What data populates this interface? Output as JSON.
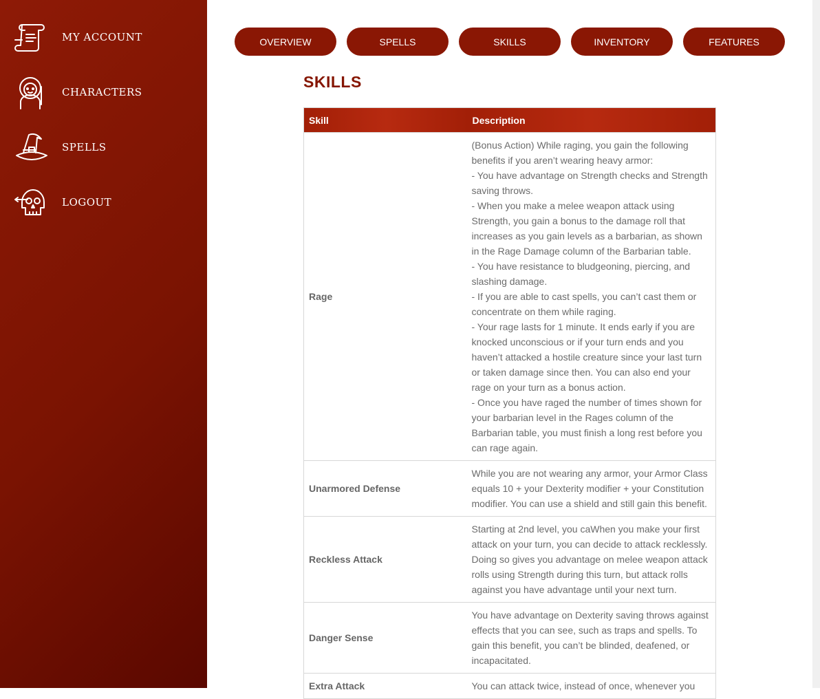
{
  "sidebar": {
    "items": [
      {
        "label": "MY ACCOUNT",
        "icon": "scroll-icon"
      },
      {
        "label": "CHARACTERS",
        "icon": "character-icon"
      },
      {
        "label": "SPELLS",
        "icon": "wizard-hat-icon"
      },
      {
        "label": "LOGOUT",
        "icon": "skull-icon"
      }
    ]
  },
  "tabs": [
    "OVERVIEW",
    "SPELLS",
    "SKILLS",
    "INVENTORY",
    "FEATURES"
  ],
  "page_title": "SKILLS",
  "table": {
    "headers": [
      "Skill",
      "Description"
    ],
    "rows": [
      {
        "skill": "Rage",
        "description": "(Bonus Action) While raging, you gain the following benefits if you aren’t wearing heavy armor:\n- You have advantage on Strength checks and Strength saving throws.\n- When you make a melee weapon attack using Strength, you gain a bonus to the damage roll that increases as you gain levels as a barbarian, as shown in the Rage Damage column of the Barbarian table.\n- You have resistance to bludgeoning, piercing, and slashing damage.\n- If you are able to cast spells, you can’t cast them or concentrate on them while raging.\n- Your rage lasts for 1 minute. It ends early if you are knocked unconscious or if your turn ends and you haven’t attacked a hostile creature since your last turn or taken damage since then. You can also end your rage on your turn as a bonus action.\n- Once you have raged the number of times shown for your barbarian level in the Rages column of the Barbarian table, you must finish a long rest before you can rage again."
      },
      {
        "skill": "Unarmored Defense",
        "description": "While you are not wearing any armor, your Armor Class equals 10 + your Dexterity modifier + your Constitution modifier. You can use a shield and still gain this benefit."
      },
      {
        "skill": "Reckless Attack",
        "description": "Starting at 2nd level, you caWhen you make your first attack on your turn, you can decide to attack recklessly. Doing so gives you advantage on melee weapon attack rolls using Strength during this turn, but attack rolls against you have advantage until your next turn."
      },
      {
        "skill": "Danger Sense",
        "description": "You have advantage on Dexterity saving throws against effects that you can see, such as traps and spells. To gain this benefit, you can’t be blinded, deafened, or incapacitated."
      },
      {
        "skill": "Extra Attack",
        "description": "You can attack twice, instead of once, whenever you"
      }
    ]
  },
  "colors": {
    "brand": "#8a1704",
    "header": "#b02610",
    "title": "#851500"
  }
}
